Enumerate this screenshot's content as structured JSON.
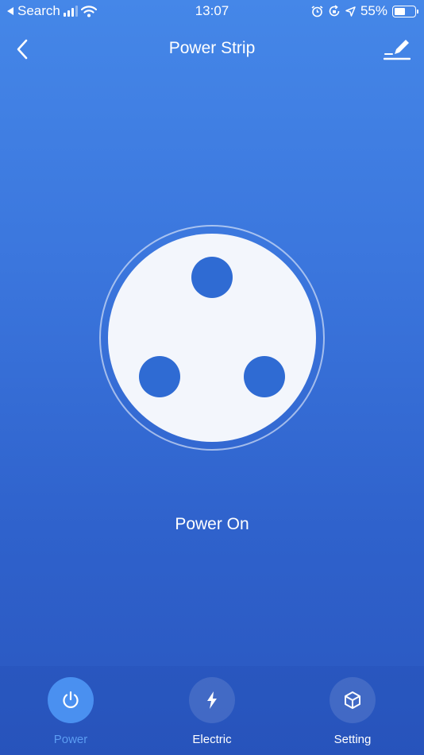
{
  "status_bar": {
    "back_app": "Search",
    "time": "13:07",
    "battery": "55%",
    "battery_level": 0.55,
    "icons": [
      "back-arrow-icon",
      "signal-icon",
      "wifi-icon",
      "alarm-icon",
      "rotation-lock-icon",
      "location-icon",
      "battery-icon"
    ]
  },
  "nav": {
    "title": "Power Strip",
    "back_icon": "chevron-left-icon",
    "edit_icon": "edit-icon"
  },
  "device": {
    "status": "Power On",
    "socket_icon": "socket-icon"
  },
  "tabs": [
    {
      "label": "Power",
      "icon": "power-icon",
      "active": true
    },
    {
      "label": "Electric",
      "icon": "lightning-icon",
      "active": false
    },
    {
      "label": "Setting",
      "icon": "cube-icon",
      "active": false
    }
  ],
  "colors": {
    "background_top": "#4587e8",
    "background_bottom": "#2a56bf",
    "socket_face": "#f3f6fc",
    "socket_pin": "#2f6bd3",
    "active_tab": "#4a90f0",
    "active_tab_label": "#5b9cf2"
  }
}
